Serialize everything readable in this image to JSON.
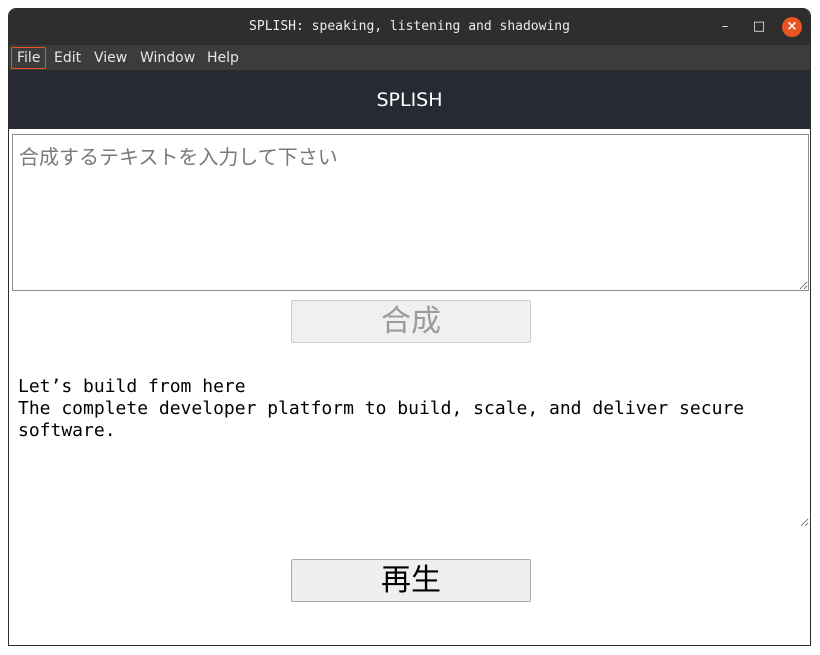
{
  "window": {
    "title": "SPLISH: speaking, listening and shadowing",
    "controls": {
      "minimize": "–",
      "maximize": "□",
      "close": "×"
    }
  },
  "menubar": {
    "items": [
      {
        "label": "File"
      },
      {
        "label": "Edit"
      },
      {
        "label": "View"
      },
      {
        "label": "Window"
      },
      {
        "label": "Help"
      }
    ]
  },
  "header": {
    "title": "SPLISH"
  },
  "synthesis": {
    "placeholder": "合成するテキストを入力して下さい",
    "value": "",
    "button_label": "合成",
    "button_enabled": false
  },
  "output": {
    "text": "Let’s build from here\nThe complete developer platform to build, scale, and deliver secure software."
  },
  "playback": {
    "button_label": "再生"
  },
  "colors": {
    "accent": "#e95420",
    "header_bg": "#262a33",
    "titlebar_bg": "#2e2e2e",
    "menubar_bg": "#3c3c3c"
  }
}
